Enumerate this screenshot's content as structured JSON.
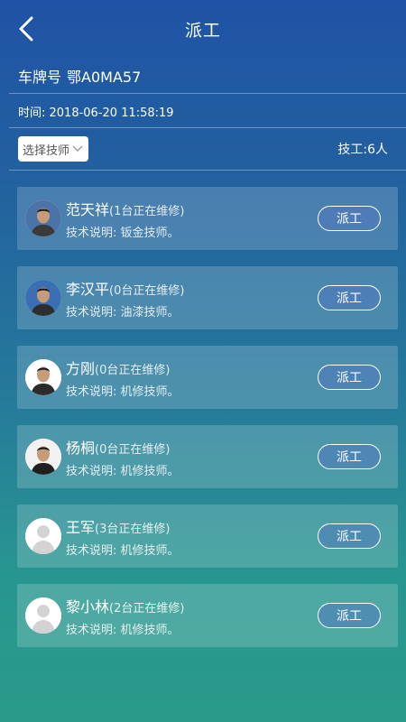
{
  "header": {
    "title": "派工",
    "back_icon": "chevron-left-icon"
  },
  "plate": {
    "label": "车牌号",
    "value": "鄂A0MA57"
  },
  "time": {
    "text": "时间: 2018-06-20 11:58:19"
  },
  "filter": {
    "select_label": "选择技师",
    "count_text": "技工:6人"
  },
  "technicians": [
    {
      "name": "范天祥",
      "status": "(1台正在维修)",
      "desc": "技术说明: 钣金技师。",
      "button": "派工",
      "avatar": "photo"
    },
    {
      "name": "李汉平",
      "status": "(0台正在维修)",
      "desc": "技术说明: 油漆技师。",
      "button": "派工",
      "avatar": "photo"
    },
    {
      "name": "方刚",
      "status": "(0台正在维修)",
      "desc": "技术说明: 机修技师。",
      "button": "派工",
      "avatar": "photo"
    },
    {
      "name": "杨桐",
      "status": "(0台正在维修)",
      "desc": "技术说明: 机修技师。",
      "button": "派工",
      "avatar": "photo"
    },
    {
      "name": "王军",
      "status": "(3台正在维修)",
      "desc": "技术说明: 机修技师。",
      "button": "派工",
      "avatar": "placeholder"
    },
    {
      "name": "黎小林",
      "status": "(2台正在维修)",
      "desc": "技术说明: 机修技师。",
      "button": "派工",
      "avatar": "placeholder"
    }
  ]
}
